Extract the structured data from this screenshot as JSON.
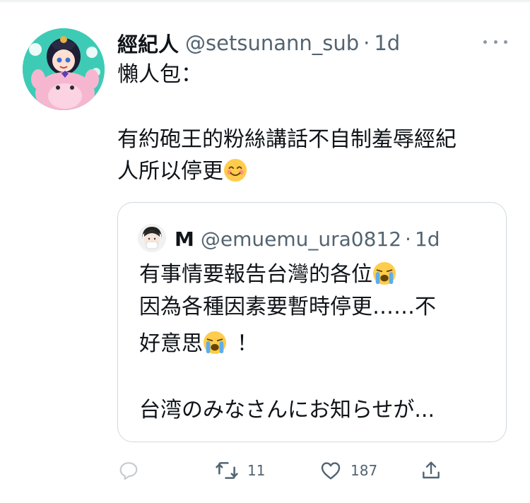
{
  "tweet": {
    "author_name": "經紀人",
    "author_handle": "@setsunann_sub",
    "separator": "·",
    "time": "1d",
    "text_line1": "懶人包：",
    "text_line2": "有約砲王的粉絲講話不自制羞辱經紀",
    "text_line3": "人所以停更",
    "more_icon": "more-dots-icon"
  },
  "quote": {
    "author_name": "M",
    "author_handle": "@emuemu_ura0812",
    "separator": "·",
    "time": "1d",
    "line1": "有事情要報告台灣的各位",
    "line2": "因為各種因素要暫時停更……不",
    "line3": "好意思",
    "line3_suffix": "！",
    "line4": "台湾のみなさんにお知らせが..."
  },
  "actions": {
    "reply_count": "",
    "retweet_count": "11",
    "like_count": "187",
    "icons": [
      "reply-icon",
      "retweet-icon",
      "like-icon",
      "share-icon"
    ]
  },
  "colors": {
    "text": "#0f1419",
    "secondary": "#536471",
    "border": "#cfd9de",
    "avatar_bg": "#3ecbb6"
  }
}
